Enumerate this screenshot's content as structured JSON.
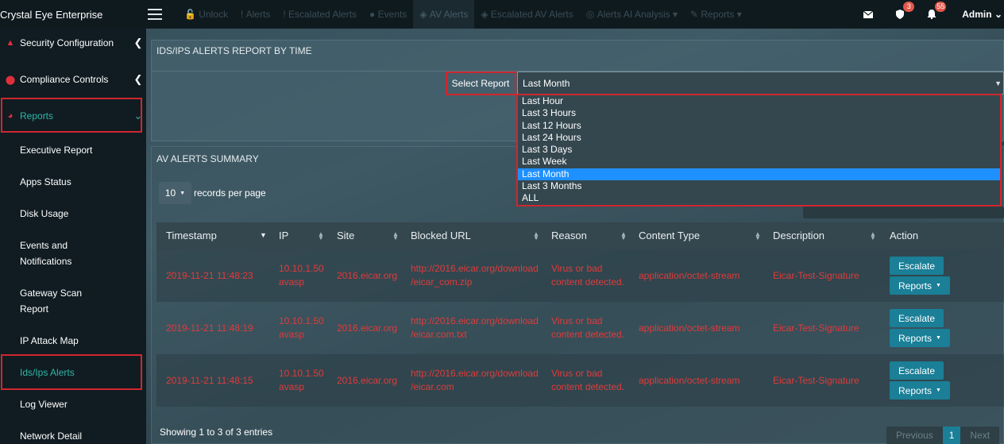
{
  "app": {
    "title": "Crystal Eye Enterprise"
  },
  "topnav": [
    "Unlock",
    "Alerts",
    "Escalated Alerts",
    "Events",
    "AV Alerts",
    "Escalated AV Alerts",
    "Alerts AI Analysis",
    "Reports"
  ],
  "topright": {
    "shield_badge": "3",
    "bell_badge": "55",
    "admin_label": "Admin"
  },
  "sidebar": {
    "security_configuration": "Security Configuration",
    "compliance_controls": "Compliance Controls",
    "reports": "Reports",
    "subitems": [
      "Executive Report",
      "Apps Status",
      "Disk Usage",
      "Events and",
      "Notifications",
      "Gateway Scan",
      "Report",
      "IP Attack Map",
      "Ids/Ips Alerts",
      "Log Viewer",
      "Network Detail"
    ]
  },
  "report_panel": {
    "title": "IDS/IPS ALERTS REPORT BY TIME",
    "select_label": "Select Report",
    "selected_value": "Last Month",
    "options": [
      "Last Hour",
      "Last 3 Hours",
      "Last 12 Hours",
      "Last 24 Hours",
      "Last 3 Days",
      "Last Week",
      "Last Month",
      "Last 3 Months",
      "ALL"
    ]
  },
  "summary_panel": {
    "title": "AV ALERTS SUMMARY",
    "per_page_value": "10",
    "per_page_label": "records per page",
    "columns": [
      "Timestamp",
      "IP",
      "Site",
      "Blocked URL",
      "Reason",
      "Content Type",
      "Description",
      "Action"
    ],
    "rows": [
      {
        "timestamp": "2019-11-21 11:48:23",
        "ip_1": "10.10.1.50",
        "ip_2": "avasp",
        "site": "2016.eicar.org",
        "url_1": "http://2016.eicar.org/download",
        "url_2": "/eicar_com.zip",
        "reason_1": "Virus or bad",
        "reason_2": "content detected.",
        "content_type": "application/octet-stream",
        "description": "Eicar-Test-Signature"
      },
      {
        "timestamp": "2019-11-21 11:48:19",
        "ip_1": "10.10.1.50",
        "ip_2": "avasp",
        "site": "2016.eicar.org",
        "url_1": "http://2016.eicar.org/download",
        "url_2": "/eicar.com.txt",
        "reason_1": "Virus or bad",
        "reason_2": "content detected.",
        "content_type": "application/octet-stream",
        "description": "Eicar-Test-Signature"
      },
      {
        "timestamp": "2019-11-21 11:48:15",
        "ip_1": "10.10.1.50",
        "ip_2": "avasp",
        "site": "2016.eicar.org",
        "url_1": "http://2016.eicar.org/download",
        "url_2": "/eicar.com",
        "reason_1": "Virus or bad",
        "reason_2": "content detected.",
        "content_type": "application/octet-stream",
        "description": "Eicar-Test-Signature"
      }
    ],
    "escalate_label": "Escalate",
    "reports_label": "Reports",
    "showing_text": "Showing 1 to 3 of 3 entries",
    "pager": {
      "previous": "Previous",
      "current": "1",
      "next": "Next"
    }
  },
  "colors": {
    "accent_teal": "#1a7f97",
    "highlight_red": "#d0262e",
    "alert_text": "#e23a3a",
    "selected_option": "#1e90ff"
  }
}
